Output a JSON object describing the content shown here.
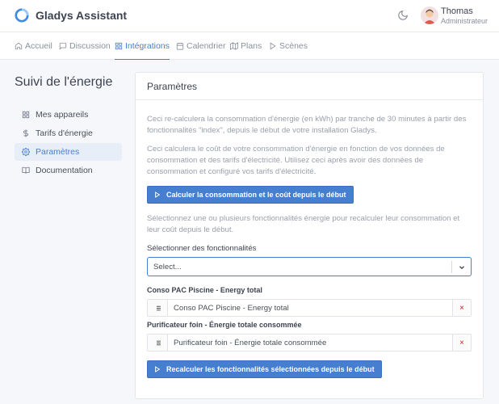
{
  "header": {
    "app_name": "Gladys Assistant",
    "user_name": "Thomas",
    "user_role": "Administrateur"
  },
  "nav": [
    {
      "label": "Accueil",
      "icon": "home-icon",
      "active": false
    },
    {
      "label": "Discussion",
      "icon": "message-square-icon",
      "active": false
    },
    {
      "label": "Intégrations",
      "icon": "grid-icon",
      "active": true
    },
    {
      "label": "Calendrier",
      "icon": "calendar-icon",
      "active": false
    },
    {
      "label": "Plans",
      "icon": "map-icon",
      "active": false
    },
    {
      "label": "Scènes",
      "icon": "play-icon",
      "active": false
    }
  ],
  "sidebar": {
    "title": "Suivi de l'énergie",
    "items": [
      {
        "label": "Mes appareils",
        "icon": "grid-icon",
        "active": false
      },
      {
        "label": "Tarifs d'énergie",
        "icon": "dollar-icon",
        "active": false
      },
      {
        "label": "Paramètres",
        "icon": "gear-icon",
        "active": true
      },
      {
        "label": "Documentation",
        "icon": "book-icon",
        "active": false
      }
    ]
  },
  "card": {
    "title": "Paramètres",
    "paragraph1": "Ceci re-calculera la consommation d'énergie (en kWh) par tranche de 30 minutes à partir des fonctionnalités \"index\", depuis le début de votre installation Gladys.",
    "paragraph2": "Ceci calculera le coût de votre consommation d'énergie en fonction de vos données de consommation et des tarifs d'électricité. Utilisez ceci après avoir des données de consommation et configuré vos tarifs d'électricité.",
    "calc_button_label": "Calculer la consommation et le coût depuis le début",
    "paragraph3": "Sélectionnez une ou plusieurs fonctionnalités énergie pour recalculer leur consommation et leur coût depuis le début.",
    "select_label": "Sélectionner des fonctionnalités",
    "select_placeholder": "Select...",
    "features": [
      {
        "title": "Conso PAC Piscine - Energy total",
        "name": "Conso PAC Piscine - Energy total",
        "remove": "×"
      },
      {
        "title": "Purificateur foin - Énergie totale consommée",
        "name": "Purificateur foin - Énergie totale consommée",
        "remove": "×"
      }
    ],
    "recalc_button_label": "Recalculer les fonctionnalités sélectionnées depuis le début"
  },
  "colors": {
    "accent": "#467fcf",
    "danger": "#cd201f"
  }
}
